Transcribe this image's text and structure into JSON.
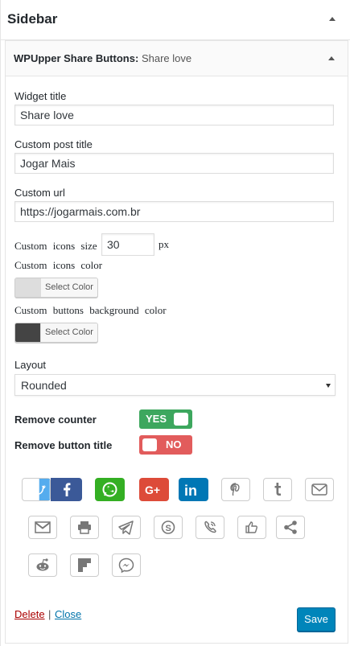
{
  "sidebar": {
    "title": "Sidebar"
  },
  "widget": {
    "name": "WPUpper Share Buttons",
    "separator": ":",
    "instance_title": "Share love"
  },
  "fields": {
    "widget_title": {
      "label": "Widget title",
      "value": "Share love"
    },
    "custom_post_title": {
      "label": "Custom post title",
      "value": "Jogar Mais"
    },
    "custom_url": {
      "label": "Custom url",
      "value": "https://jogarmais.com.br"
    },
    "icons_size": {
      "label": "Custom icons size",
      "value": "30",
      "unit": "px"
    },
    "icons_color": {
      "label": "Custom icons color",
      "button": "Select Color",
      "color": "#dddddd"
    },
    "buttons_bg_color": {
      "label": "Custom buttons background color",
      "button": "Select Color",
      "color": "#444444"
    },
    "layout": {
      "label": "Layout",
      "selected": "Rounded"
    },
    "remove_counter": {
      "label": "Remove counter",
      "state": "YES",
      "on": true
    },
    "remove_button_title": {
      "label": "Remove button title",
      "state": "NO",
      "on": false
    }
  },
  "share_buttons": [
    {
      "network": "twitter",
      "icon": "twitter-icon",
      "active": true
    },
    {
      "network": "facebook",
      "icon": "facebook-icon",
      "active": true,
      "color": "#3b5998"
    },
    {
      "network": "whatsapp",
      "icon": "whatsapp-icon",
      "active": true,
      "color": "#34af23"
    },
    {
      "network": "google-plus",
      "icon": "google-plus-icon",
      "active": true,
      "color": "#dd4b39"
    },
    {
      "network": "linkedin",
      "icon": "linkedin-icon",
      "active": true,
      "color": "#0077b5"
    },
    {
      "network": "pinterest",
      "icon": "pinterest-icon",
      "active": false
    },
    {
      "network": "tumblr",
      "icon": "tumblr-icon",
      "active": false
    },
    {
      "network": "email",
      "icon": "envelope-icon",
      "active": false
    },
    {
      "network": "gmail",
      "icon": "gmail-icon",
      "active": false
    },
    {
      "network": "print",
      "icon": "printer-icon",
      "active": false
    },
    {
      "network": "telegram",
      "icon": "paper-plane-icon",
      "active": false
    },
    {
      "network": "skype",
      "icon": "skype-icon",
      "active": false
    },
    {
      "network": "viber",
      "icon": "viber-icon",
      "active": false
    },
    {
      "network": "like",
      "icon": "thumbs-up-icon",
      "active": false
    },
    {
      "network": "share",
      "icon": "share-icon",
      "active": false
    },
    {
      "network": "reddit",
      "icon": "reddit-icon",
      "active": false
    },
    {
      "network": "flipboard",
      "icon": "flipboard-icon",
      "active": false
    },
    {
      "network": "messenger",
      "icon": "messenger-icon",
      "active": false
    }
  ],
  "actions": {
    "delete": "Delete",
    "separator": "|",
    "close": "Close",
    "save": "Save"
  },
  "colors": {
    "save_button": "#0085ba",
    "toggle_yes": "#3da75e",
    "toggle_no": "#e25c5c",
    "delete_link": "#aa0000",
    "close_link": "#0073aa"
  }
}
